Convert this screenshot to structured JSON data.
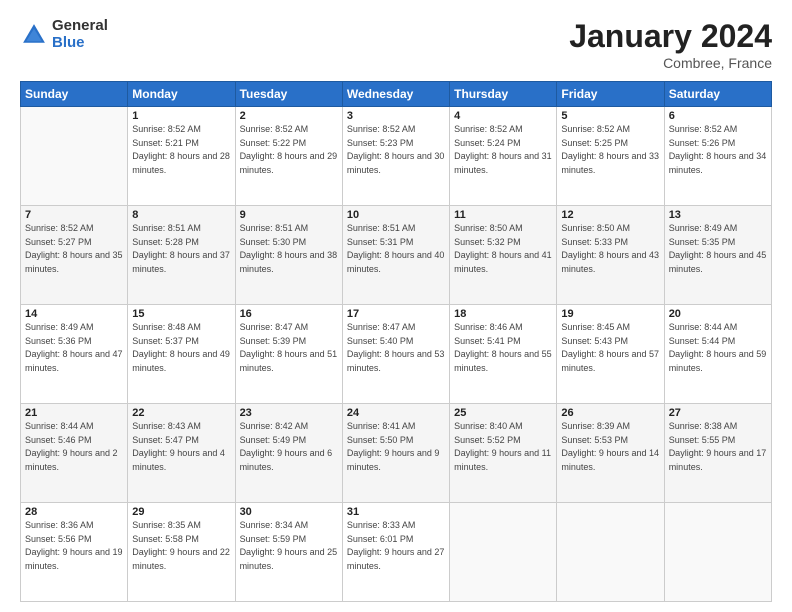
{
  "logo": {
    "general": "General",
    "blue": "Blue"
  },
  "title": "January 2024",
  "location": "Combree, France",
  "days_header": [
    "Sunday",
    "Monday",
    "Tuesday",
    "Wednesday",
    "Thursday",
    "Friday",
    "Saturday"
  ],
  "weeks": [
    [
      {
        "day": "",
        "sunrise": "",
        "sunset": "",
        "daylight": ""
      },
      {
        "day": "1",
        "sunrise": "Sunrise: 8:52 AM",
        "sunset": "Sunset: 5:21 PM",
        "daylight": "Daylight: 8 hours and 28 minutes."
      },
      {
        "day": "2",
        "sunrise": "Sunrise: 8:52 AM",
        "sunset": "Sunset: 5:22 PM",
        "daylight": "Daylight: 8 hours and 29 minutes."
      },
      {
        "day": "3",
        "sunrise": "Sunrise: 8:52 AM",
        "sunset": "Sunset: 5:23 PM",
        "daylight": "Daylight: 8 hours and 30 minutes."
      },
      {
        "day": "4",
        "sunrise": "Sunrise: 8:52 AM",
        "sunset": "Sunset: 5:24 PM",
        "daylight": "Daylight: 8 hours and 31 minutes."
      },
      {
        "day": "5",
        "sunrise": "Sunrise: 8:52 AM",
        "sunset": "Sunset: 5:25 PM",
        "daylight": "Daylight: 8 hours and 33 minutes."
      },
      {
        "day": "6",
        "sunrise": "Sunrise: 8:52 AM",
        "sunset": "Sunset: 5:26 PM",
        "daylight": "Daylight: 8 hours and 34 minutes."
      }
    ],
    [
      {
        "day": "7",
        "sunrise": "Sunrise: 8:52 AM",
        "sunset": "Sunset: 5:27 PM",
        "daylight": "Daylight: 8 hours and 35 minutes."
      },
      {
        "day": "8",
        "sunrise": "Sunrise: 8:51 AM",
        "sunset": "Sunset: 5:28 PM",
        "daylight": "Daylight: 8 hours and 37 minutes."
      },
      {
        "day": "9",
        "sunrise": "Sunrise: 8:51 AM",
        "sunset": "Sunset: 5:30 PM",
        "daylight": "Daylight: 8 hours and 38 minutes."
      },
      {
        "day": "10",
        "sunrise": "Sunrise: 8:51 AM",
        "sunset": "Sunset: 5:31 PM",
        "daylight": "Daylight: 8 hours and 40 minutes."
      },
      {
        "day": "11",
        "sunrise": "Sunrise: 8:50 AM",
        "sunset": "Sunset: 5:32 PM",
        "daylight": "Daylight: 8 hours and 41 minutes."
      },
      {
        "day": "12",
        "sunrise": "Sunrise: 8:50 AM",
        "sunset": "Sunset: 5:33 PM",
        "daylight": "Daylight: 8 hours and 43 minutes."
      },
      {
        "day": "13",
        "sunrise": "Sunrise: 8:49 AM",
        "sunset": "Sunset: 5:35 PM",
        "daylight": "Daylight: 8 hours and 45 minutes."
      }
    ],
    [
      {
        "day": "14",
        "sunrise": "Sunrise: 8:49 AM",
        "sunset": "Sunset: 5:36 PM",
        "daylight": "Daylight: 8 hours and 47 minutes."
      },
      {
        "day": "15",
        "sunrise": "Sunrise: 8:48 AM",
        "sunset": "Sunset: 5:37 PM",
        "daylight": "Daylight: 8 hours and 49 minutes."
      },
      {
        "day": "16",
        "sunrise": "Sunrise: 8:47 AM",
        "sunset": "Sunset: 5:39 PM",
        "daylight": "Daylight: 8 hours and 51 minutes."
      },
      {
        "day": "17",
        "sunrise": "Sunrise: 8:47 AM",
        "sunset": "Sunset: 5:40 PM",
        "daylight": "Daylight: 8 hours and 53 minutes."
      },
      {
        "day": "18",
        "sunrise": "Sunrise: 8:46 AM",
        "sunset": "Sunset: 5:41 PM",
        "daylight": "Daylight: 8 hours and 55 minutes."
      },
      {
        "day": "19",
        "sunrise": "Sunrise: 8:45 AM",
        "sunset": "Sunset: 5:43 PM",
        "daylight": "Daylight: 8 hours and 57 minutes."
      },
      {
        "day": "20",
        "sunrise": "Sunrise: 8:44 AM",
        "sunset": "Sunset: 5:44 PM",
        "daylight": "Daylight: 8 hours and 59 minutes."
      }
    ],
    [
      {
        "day": "21",
        "sunrise": "Sunrise: 8:44 AM",
        "sunset": "Sunset: 5:46 PM",
        "daylight": "Daylight: 9 hours and 2 minutes."
      },
      {
        "day": "22",
        "sunrise": "Sunrise: 8:43 AM",
        "sunset": "Sunset: 5:47 PM",
        "daylight": "Daylight: 9 hours and 4 minutes."
      },
      {
        "day": "23",
        "sunrise": "Sunrise: 8:42 AM",
        "sunset": "Sunset: 5:49 PM",
        "daylight": "Daylight: 9 hours and 6 minutes."
      },
      {
        "day": "24",
        "sunrise": "Sunrise: 8:41 AM",
        "sunset": "Sunset: 5:50 PM",
        "daylight": "Daylight: 9 hours and 9 minutes."
      },
      {
        "day": "25",
        "sunrise": "Sunrise: 8:40 AM",
        "sunset": "Sunset: 5:52 PM",
        "daylight": "Daylight: 9 hours and 11 minutes."
      },
      {
        "day": "26",
        "sunrise": "Sunrise: 8:39 AM",
        "sunset": "Sunset: 5:53 PM",
        "daylight": "Daylight: 9 hours and 14 minutes."
      },
      {
        "day": "27",
        "sunrise": "Sunrise: 8:38 AM",
        "sunset": "Sunset: 5:55 PM",
        "daylight": "Daylight: 9 hours and 17 minutes."
      }
    ],
    [
      {
        "day": "28",
        "sunrise": "Sunrise: 8:36 AM",
        "sunset": "Sunset: 5:56 PM",
        "daylight": "Daylight: 9 hours and 19 minutes."
      },
      {
        "day": "29",
        "sunrise": "Sunrise: 8:35 AM",
        "sunset": "Sunset: 5:58 PM",
        "daylight": "Daylight: 9 hours and 22 minutes."
      },
      {
        "day": "30",
        "sunrise": "Sunrise: 8:34 AM",
        "sunset": "Sunset: 5:59 PM",
        "daylight": "Daylight: 9 hours and 25 minutes."
      },
      {
        "day": "31",
        "sunrise": "Sunrise: 8:33 AM",
        "sunset": "Sunset: 6:01 PM",
        "daylight": "Daylight: 9 hours and 27 minutes."
      },
      {
        "day": "",
        "sunrise": "",
        "sunset": "",
        "daylight": ""
      },
      {
        "day": "",
        "sunrise": "",
        "sunset": "",
        "daylight": ""
      },
      {
        "day": "",
        "sunrise": "",
        "sunset": "",
        "daylight": ""
      }
    ]
  ]
}
